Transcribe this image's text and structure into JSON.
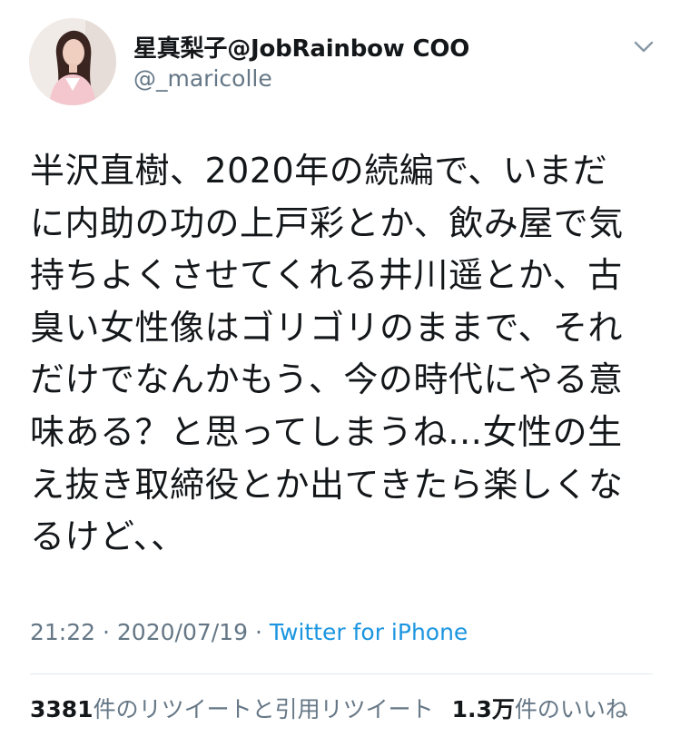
{
  "author": {
    "display_name": "星真梨子@JobRainbow COO",
    "handle": "@_maricolle"
  },
  "tweet": {
    "lines": [
      "半沢直樹、2020年の続編で、いまだ",
      "に内助の功の上戸彩とか、飲み屋で気",
      "持ちよくさせてくれる井川遥とか、古",
      "臭い女性像はゴリゴリのままで、それ",
      "だけでなんかもう、今の時代にやる意",
      "味ある？と思ってしまうね…女性の生",
      "え抜き取締役とか出てきたら楽しくな",
      "るけど、、"
    ],
    "time": "21:22",
    "separator": "·",
    "date": "2020/07/19",
    "source": "Twitter for iPhone"
  },
  "stats": {
    "retweets_count": "3381",
    "retweets_label": "件のリツイートと引用リツイート",
    "likes_count": "1.3万",
    "likes_label": "件のいいね"
  },
  "icons": {
    "avatar": "profile-photo",
    "caret": "chevron-down-icon"
  },
  "colors": {
    "text": "#14171a",
    "secondary": "#657786",
    "link": "#1b95e0",
    "divider": "#e1e8ed"
  }
}
